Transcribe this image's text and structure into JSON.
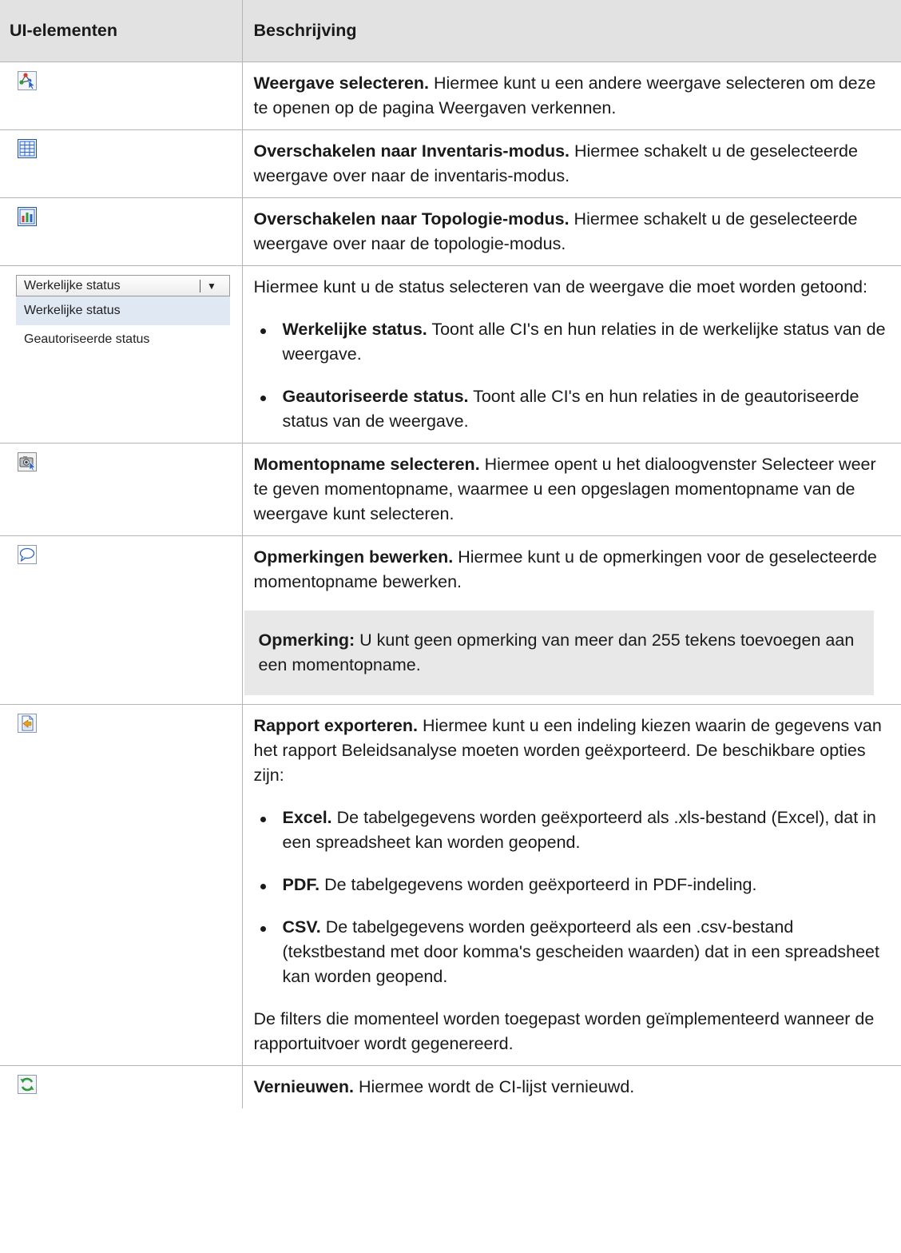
{
  "header": {
    "col1": "UI-elementen",
    "col2": "Beschrijving"
  },
  "rows": [
    {
      "icon": "select-view-icon",
      "title": "Weergave selecteren.",
      "text": " Hiermee kunt u een andere weergave selecteren om deze te openen op de pagina Weergaven verkennen."
    },
    {
      "icon": "inventory-mode-icon",
      "title": "Overschakelen naar Inventaris-modus.",
      "text": " Hiermee schakelt u de geselecteerde weergave over naar de inventaris-modus."
    },
    {
      "icon": "topology-mode-icon",
      "title": "Overschakelen naar Topologie-modus.",
      "text": " Hiermee schakelt u de geselecteerde weergave over naar de topologie-modus."
    },
    {
      "dropdown": {
        "selected": "Werkelijke status",
        "options": [
          "Werkelijke status",
          "Geautoriseerde status"
        ]
      },
      "intro": "Hiermee kunt u de status selecteren van de weergave die moet worden getoond:",
      "bullets": [
        {
          "title": "Werkelijke status.",
          "text": " Toont alle CI's en hun relaties in de werkelijke status van de weergave."
        },
        {
          "title": "Geautoriseerde status.",
          "text": " Toont alle CI's en hun relaties in de geautoriseerde status van de weergave."
        }
      ]
    },
    {
      "icon": "snapshot-select-icon",
      "title": "Momentopname selecteren.",
      "text": " Hiermee opent u het dialoogvenster Selecteer weer te geven momentopname, waarmee u een opgeslagen momentopname van de weergave kunt selecteren."
    },
    {
      "icon": "comment-bubble-icon",
      "title": "Opmerkingen bewerken.",
      "text": " Hiermee kunt u de opmerkingen voor de geselecteerde momentopname bewerken.",
      "note_title": "Opmerking:",
      "note_text": " U kunt geen opmerking van meer dan 255 tekens toevoegen aan een momentopname."
    },
    {
      "icon": "export-report-icon",
      "title": "Rapport exporteren.",
      "text": " Hiermee kunt u een indeling kiezen waarin de gegevens van het rapport Beleidsanalyse moeten worden geëxporteerd. De beschikbare opties zijn:",
      "bullets": [
        {
          "title": "Excel.",
          "text": " De tabelgegevens worden geëxporteerd als .xls-bestand (Excel), dat in een spreadsheet kan worden geopend."
        },
        {
          "title": "PDF.",
          "text": " De tabelgegevens worden geëxporteerd in PDF-indeling."
        },
        {
          "title": "CSV.",
          "text": " De tabelgegevens worden geëxporteerd als een .csv-bestand (tekstbestand met door komma's gescheiden waarden) dat in een spreadsheet kan worden geopend."
        }
      ],
      "after": "De filters die momenteel worden toegepast worden geïmplementeerd wanneer de rapportuitvoer wordt gegenereerd."
    },
    {
      "icon": "refresh-icon",
      "title": "Vernieuwen.",
      "text": " Hiermee wordt de CI-lijst vernieuwd."
    }
  ]
}
